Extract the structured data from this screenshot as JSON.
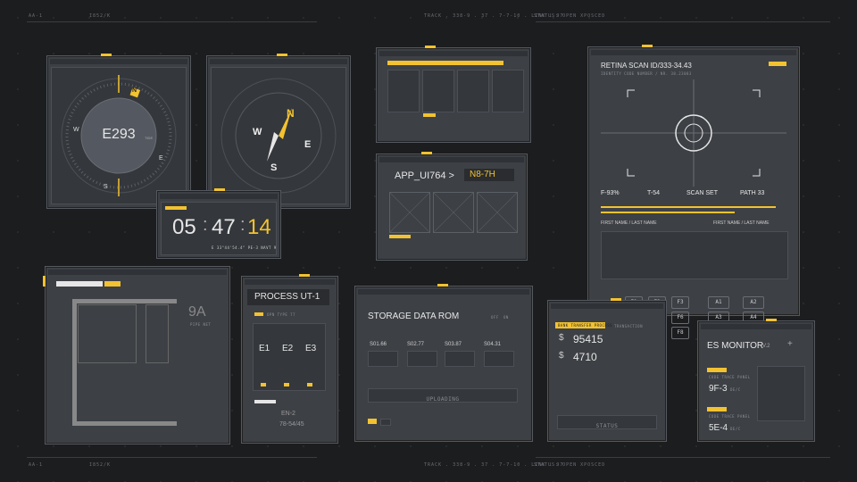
{
  "edges": {
    "top_left": "AA-1",
    "top_code": "I852/K",
    "top_track": "TRACK . 338-9 . 37 . 7-7-10 . LINK . 97",
    "top_status": "STATUS: OPEN XPOSCED",
    "bottom_left": "AA-1",
    "bottom_code": "I852/K",
    "bottom_track": "TRACK . 338-9 . 37 . 7-7-10 . LINK . 97",
    "bottom_status": "STATUS: OPEN XPOSCED"
  },
  "compass1": {
    "heading": "E293",
    "unit": "TIDE",
    "n": "N",
    "e": "E",
    "s": "S",
    "w": "W"
  },
  "compass2": {
    "n": "N",
    "e": "E",
    "s": "S",
    "w": "W"
  },
  "clock": {
    "hours": "05",
    "minutes": "47",
    "seconds": "14",
    "coords": "E 33°44'54.4\" PE-3 NAVT 9"
  },
  "gallery": {
    "thumbs": 4
  },
  "app_panel": {
    "title": "APP_UI764 >",
    "code": "N8-7H"
  },
  "retina": {
    "title": "RETINA SCAN ID/333-34.43",
    "subtitle": "IDENTITY CODE NUMBER / NR. 38.23083",
    "f_val": "F-93%",
    "t_val": "T-54",
    "scan_label": "SCAN SET",
    "path_label": "PATH 33",
    "name_left": "FIRST NAME / LAST NAME",
    "name_right": "FIRST NAME / LAST NAME",
    "fkeys": [
      "F1",
      "F2",
      "F3",
      "F6",
      "F8"
    ],
    "akeys": [
      "A1",
      "A2",
      "A3",
      "A4"
    ]
  },
  "floorplan": {
    "room": "9A",
    "sub": "PIPE NET"
  },
  "process": {
    "title": "PROCESS UT-1",
    "sub": "OPN TYPE 77",
    "cols": [
      "E1",
      "E2",
      "E3"
    ],
    "footer_code": "EN-2",
    "footer_val": "78-54/45"
  },
  "storage": {
    "title": "STORAGE DATA ROM",
    "toggles": [
      "OFF",
      "ON"
    ],
    "values": [
      "S01.66",
      "S02.77",
      "S03.87",
      "S04.31"
    ],
    "upload": "UPLOADING"
  },
  "transfer": {
    "tag": "BANK TRANSFER PROCESS",
    "label": "TRANSACTION",
    "amount1": "95415",
    "amount2": "4710",
    "currency": "$",
    "button": "STATUS"
  },
  "es_monitor": {
    "title": "ES MONITOR",
    "version": "V.2",
    "code_label": "CODE TRACE PANEL",
    "code1": "9F-3",
    "code2": "5E-4",
    "unit": "DE/C"
  },
  "colors": {
    "accent": "#f2c230",
    "panel": "#3d4045",
    "background": "#1c1d1f"
  }
}
